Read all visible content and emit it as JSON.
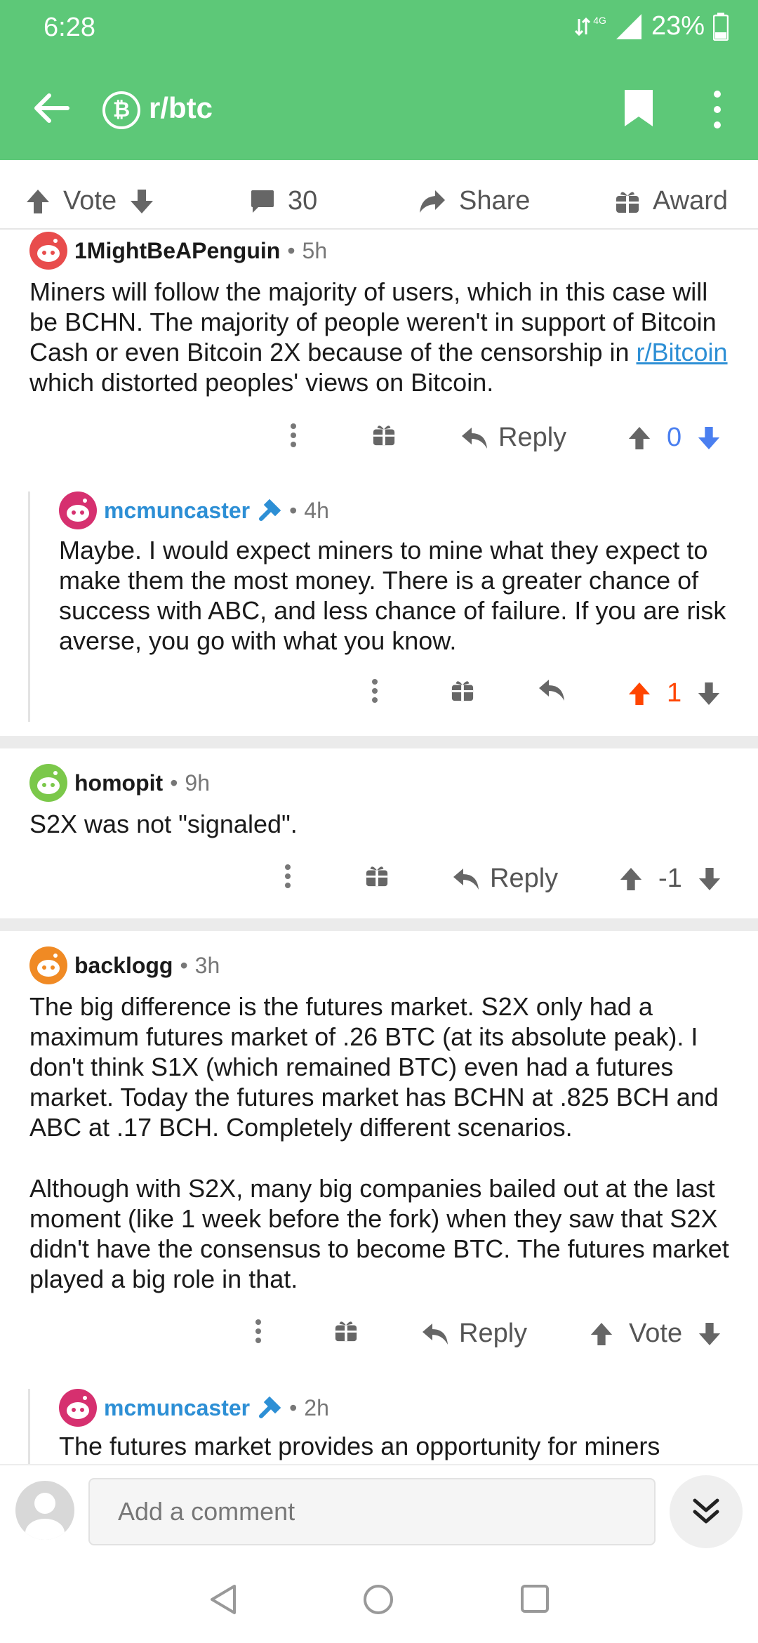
{
  "status_bar": {
    "time": "6:28",
    "network": "4G",
    "battery": "23%"
  },
  "app_bar": {
    "subreddit": "r/btc",
    "subreddit_icon": "bitcoin-icon",
    "color": "#5dc878"
  },
  "post_actions": {
    "vote_label": "Vote",
    "comments_count": "30",
    "share_label": "Share",
    "award_label": "Award"
  },
  "comments": [
    {
      "author": "1MightBeAPenguin",
      "time": "5h",
      "body_before_link": "Miners will follow the majority of users, which in this case will be BCHN. The majority of people weren't in support of Bitcoin Cash or even Bitcoin 2X because of the censorship in ",
      "link": "r/Bitcoin",
      "body_after_link": " which distorted peoples' views on Bitcoin.",
      "reply_label": "Reply",
      "score": "0"
    },
    {
      "author": "mcmuncaster",
      "time": "4h",
      "body": "Maybe. I would expect miners to mine what they expect to make them the most money. There is a greater chance of success with ABC, and less chance of failure. If you are risk averse, you go with what you know.",
      "score": "1"
    },
    {
      "author": "homopit",
      "time": "9h",
      "body": "S2X was not \"signaled\".",
      "reply_label": "Reply",
      "score": "-1"
    },
    {
      "author": "backlogg",
      "time": "3h",
      "body_p1": "The big difference is the futures market. S2X only had a maximum futures market of .26 BTC (at its absolute peak). I don't think S1X (which remained BTC) even had a futures market. Today the futures market has BCHN at .825 BCH and ABC at .17 BCH. Completely different scenarios.",
      "body_p2": "Although with S2X, many big companies bailed out at the last moment (like 1 week before the fork) when they saw that S2X didn't have the consensus to become BTC. The futures market played a big role in that.",
      "reply_label": "Reply",
      "score": "Vote"
    },
    {
      "author": "mcmuncaster",
      "time": "2h",
      "body": "The futures market provides an opportunity for miners"
    }
  ],
  "composer": {
    "placeholder": "Add a comment"
  }
}
